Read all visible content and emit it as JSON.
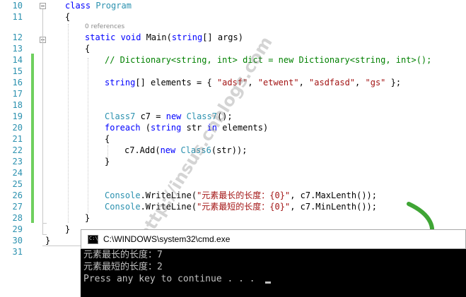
{
  "editor": {
    "codelens": "0 references",
    "lines": [
      {
        "num": "10",
        "tokens": [
          {
            "t": "class ",
            "c": "kw"
          },
          {
            "t": "Program",
            "c": "ty"
          }
        ]
      },
      {
        "num": "11",
        "tokens": [
          {
            "t": "{",
            "c": ""
          }
        ]
      },
      {
        "num": "12",
        "tokens": [
          {
            "t": "static ",
            "c": "kw"
          },
          {
            "t": "void ",
            "c": "kw"
          },
          {
            "t": "Main(",
            "c": ""
          },
          {
            "t": "string",
            "c": "kw"
          },
          {
            "t": "[] args)",
            "c": ""
          }
        ]
      },
      {
        "num": "13",
        "tokens": [
          {
            "t": "{",
            "c": ""
          }
        ]
      },
      {
        "num": "14",
        "tokens": [
          {
            "t": "// Dictionary<string, int> dict = new Dictionary<string, int>();",
            "c": "cm"
          }
        ]
      },
      {
        "num": "15",
        "tokens": []
      },
      {
        "num": "16",
        "tokens": [
          {
            "t": "string",
            "c": "kw"
          },
          {
            "t": "[] elements = { ",
            "c": ""
          },
          {
            "t": "\"adsf\"",
            "c": "st"
          },
          {
            "t": ", ",
            "c": ""
          },
          {
            "t": "\"etwent\"",
            "c": "st"
          },
          {
            "t": ", ",
            "c": ""
          },
          {
            "t": "\"asdfasd\"",
            "c": "st"
          },
          {
            "t": ", ",
            "c": ""
          },
          {
            "t": "\"gs\"",
            "c": "st"
          },
          {
            "t": " };",
            "c": ""
          }
        ]
      },
      {
        "num": "17",
        "tokens": []
      },
      {
        "num": "18",
        "tokens": []
      },
      {
        "num": "19",
        "tokens": [
          {
            "t": "Class7",
            "c": "ty"
          },
          {
            "t": " c7 = ",
            "c": ""
          },
          {
            "t": "new ",
            "c": "kw"
          },
          {
            "t": "Class7",
            "c": "ty"
          },
          {
            "t": "();",
            "c": ""
          }
        ]
      },
      {
        "num": "20",
        "tokens": [
          {
            "t": "foreach ",
            "c": "kw"
          },
          {
            "t": "(",
            "c": ""
          },
          {
            "t": "string ",
            "c": "kw"
          },
          {
            "t": "str ",
            "c": ""
          },
          {
            "t": "in ",
            "c": "kw"
          },
          {
            "t": "elements)",
            "c": ""
          }
        ]
      },
      {
        "num": "21",
        "tokens": [
          {
            "t": "{",
            "c": ""
          }
        ]
      },
      {
        "num": "22",
        "tokens": [
          {
            "t": "c7.Add(",
            "c": ""
          },
          {
            "t": "new ",
            "c": "kw"
          },
          {
            "t": "Class6",
            "c": "ty"
          },
          {
            "t": "(str));",
            "c": ""
          }
        ]
      },
      {
        "num": "23",
        "tokens": [
          {
            "t": "}",
            "c": ""
          }
        ]
      },
      {
        "num": "24",
        "tokens": []
      },
      {
        "num": "25",
        "tokens": []
      },
      {
        "num": "26",
        "tokens": [
          {
            "t": "Console",
            "c": "ty"
          },
          {
            "t": ".WriteLine(",
            "c": ""
          },
          {
            "t": "\"元素最长的长度：{0}\"",
            "c": "st"
          },
          {
            "t": ", c7.MaxLenth());",
            "c": ""
          }
        ]
      },
      {
        "num": "27",
        "tokens": [
          {
            "t": "Console",
            "c": "ty"
          },
          {
            "t": ".WriteLine(",
            "c": ""
          },
          {
            "t": "\"元素最短的长度：{0}\"",
            "c": "st"
          },
          {
            "t": ", c7.MinLenth());",
            "c": ""
          }
        ]
      },
      {
        "num": "28",
        "tokens": [
          {
            "t": "}",
            "c": ""
          }
        ]
      },
      {
        "num": "29",
        "tokens": [
          {
            "t": "}",
            "c": ""
          }
        ]
      },
      {
        "num": "30",
        "tokens": [
          {
            "t": "}",
            "c": ""
          }
        ]
      },
      {
        "num": "31",
        "tokens": []
      }
    ]
  },
  "console": {
    "title": "C:\\WINDOWS\\system32\\cmd.exe",
    "icon": "cmd-window-icon",
    "icon_text": "C:\\",
    "lines": [
      "元素最长的长度：7",
      "元素最短的长度：2",
      "Press any key to continue . . . "
    ]
  },
  "watermark": "http://insus.cnblogs.com",
  "colors": {
    "keyword": "#0000ff",
    "type": "#2b91af",
    "string": "#a31515",
    "comment": "#008000",
    "line_number": "#2b91af",
    "change_bar": "#6fcf5f",
    "arrow": "#3fa535"
  }
}
